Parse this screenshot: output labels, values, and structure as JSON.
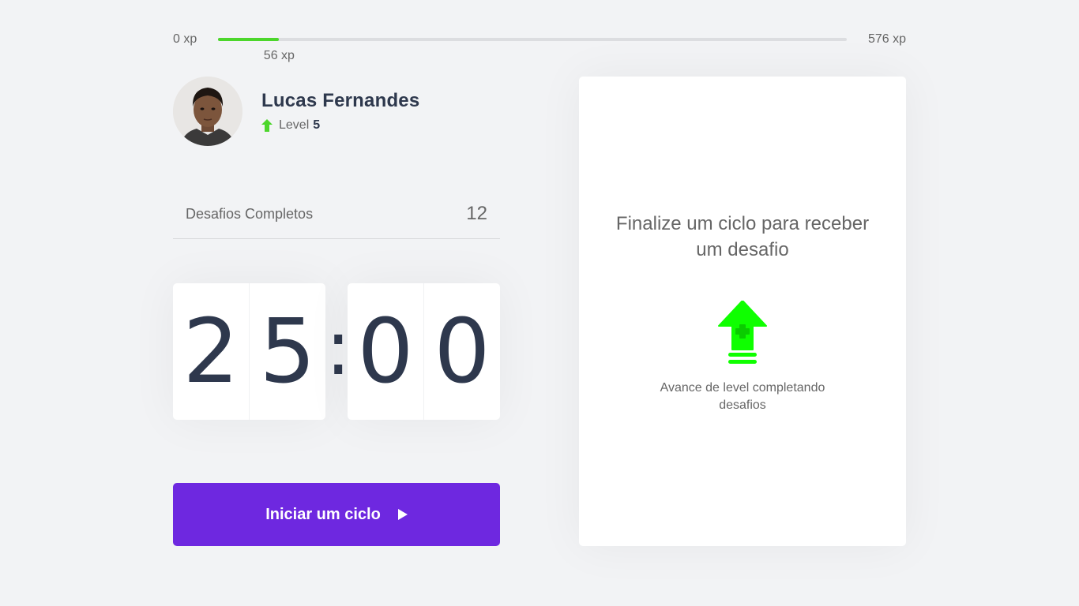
{
  "xp": {
    "min_label": "0 xp",
    "max_label": "576 xp",
    "current_label": "56 xp",
    "current": 56,
    "max": 576,
    "progress_fraction": 0.0972
  },
  "profile": {
    "name": "Lucas Fernandes",
    "level_label": "Level",
    "level_value": "5",
    "avatar_icon": "user-photo"
  },
  "completed": {
    "label": "Desafios Completos",
    "value": "12"
  },
  "countdown": {
    "minute_tens": "2",
    "minute_ones": "5",
    "separator": ":",
    "second_tens": "0",
    "second_ones": "0"
  },
  "start_button": {
    "label": "Iniciar um ciclo",
    "icon": "play-icon"
  },
  "challenge_card": {
    "title": "Finalize um ciclo para receber um desafio",
    "hint": "Avance de level completando desafios",
    "icon": "level-up-icon"
  },
  "colors": {
    "background": "#f2f3f5",
    "accent_green": "#4cd62b",
    "level_up_green": "#0fff00",
    "button_purple": "#6e28e0",
    "title_dark": "#2e384d",
    "text": "#666666"
  }
}
